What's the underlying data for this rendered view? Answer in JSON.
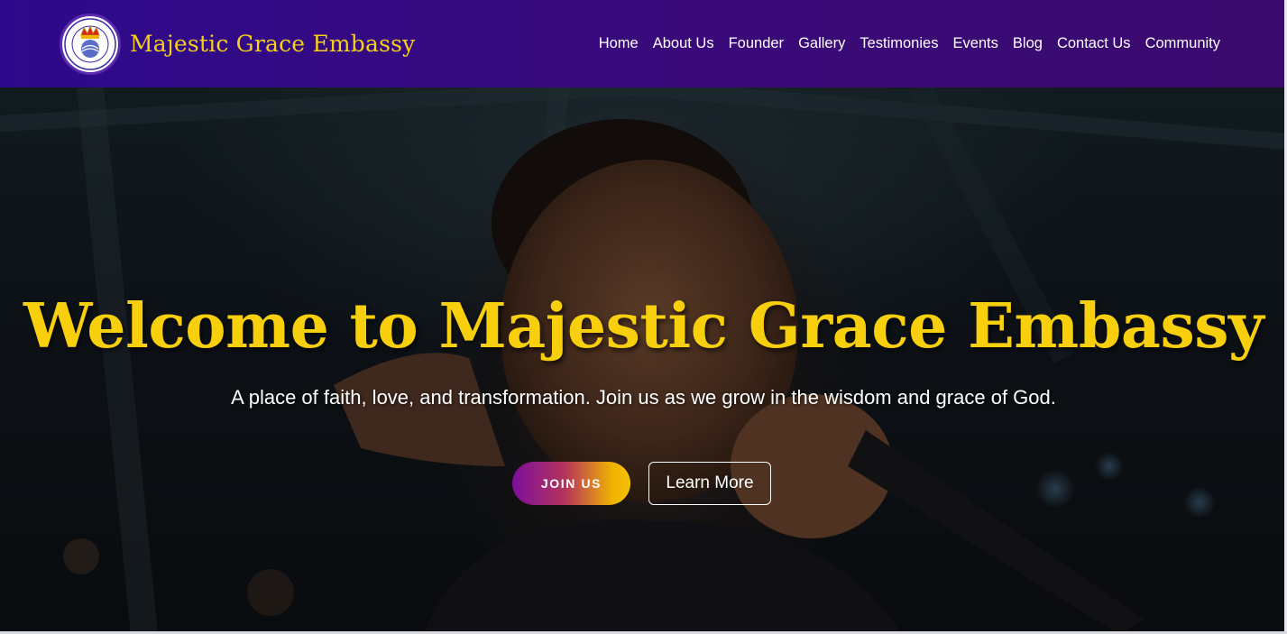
{
  "brand": {
    "name": "Majestic Grace Embassy",
    "logo_text": "MAJESTIC GRACE EMBASSY INTERNATIONAL"
  },
  "nav": {
    "items": [
      "Home",
      "About Us",
      "Founder",
      "Gallery",
      "Testimonies",
      "Events",
      "Blog",
      "Contact Us",
      "Community"
    ]
  },
  "hero": {
    "title": "Welcome to Majestic Grace Embassy",
    "subtitle": "A place of faith, love, and transformation. Join us as we grow in the wisdom and grace of God.",
    "join_label": "JOIN US",
    "learn_label": "Learn More"
  },
  "colors": {
    "nav_start": "#2d0a8c",
    "nav_end": "#3a0a6e",
    "brand_gold": "#f6cf19",
    "title_gold": "#f8cf0c"
  }
}
